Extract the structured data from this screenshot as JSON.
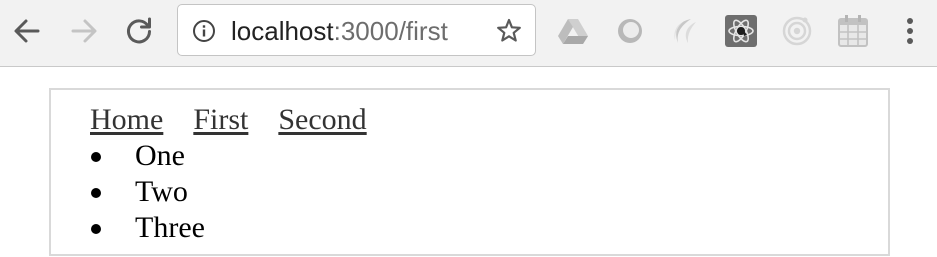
{
  "browser": {
    "address_bar": {
      "host": "localhost",
      "path": ":3000/first"
    },
    "icons": {
      "back": "arrow-left-icon",
      "forward": "arrow-right-icon",
      "reload": "reload-icon",
      "site_info": "info-icon",
      "bookmark": "star-icon",
      "extensions": [
        "google-drive-icon",
        "circle-icon",
        "swirl-icon",
        "react-devtools-icon",
        "target-icon",
        "calendar-icon"
      ],
      "menu": "kebab-menu-icon"
    }
  },
  "app": {
    "nav": [
      {
        "label": "Home"
      },
      {
        "label": "First"
      },
      {
        "label": "Second"
      }
    ],
    "list": [
      {
        "text": "One"
      },
      {
        "text": "Two"
      },
      {
        "text": "Three"
      }
    ]
  },
  "colors": {
    "toolbar_bg": "#f2f2f2",
    "link": "#333333",
    "box_border": "#d9d9d9",
    "url_path": "#6d6d6d"
  }
}
